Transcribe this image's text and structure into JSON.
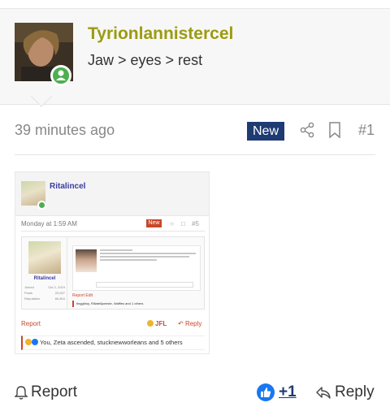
{
  "post": {
    "username": "Tyrionlannistercel",
    "user_title": "Jaw > eyes > rest",
    "time": "39 minutes ago",
    "new_label": "New",
    "post_number": "#1"
  },
  "embedded_screenshot": {
    "username": "Ritalincel",
    "time": "Monday at 1:59 AM",
    "new_label": "New",
    "post_number": "#5",
    "nested": {
      "username": "Ritalincel",
      "stats": [
        {
          "label": "Joined",
          "value": "Oct 2, 2019"
        },
        {
          "label": "Posts",
          "value": "20,637"
        },
        {
          "label": "Reputation",
          "value": "66,804"
        }
      ],
      "actions": "Report   Edit",
      "reactions": "tinggiboy, Rillatelljoneste, Waffles and 1 others"
    },
    "report_label": "Report",
    "jfl_label": "JFL",
    "reply_label": "Reply",
    "reactions": "You, Zeta ascended, stucknewworleans and 5 others"
  },
  "footer": {
    "report_label": "Report",
    "like_count": "+1",
    "reply_label": "Reply"
  },
  "colors": {
    "username": "#9b9b10",
    "new_badge": "#1e3b73",
    "accent_red": "#c8472a",
    "like_blue": "#1877f2",
    "online": "#4caf50"
  },
  "icons": [
    "share-icon",
    "bookmark-icon",
    "bell-icon",
    "like-icon",
    "reply-icon",
    "user-icon"
  ]
}
